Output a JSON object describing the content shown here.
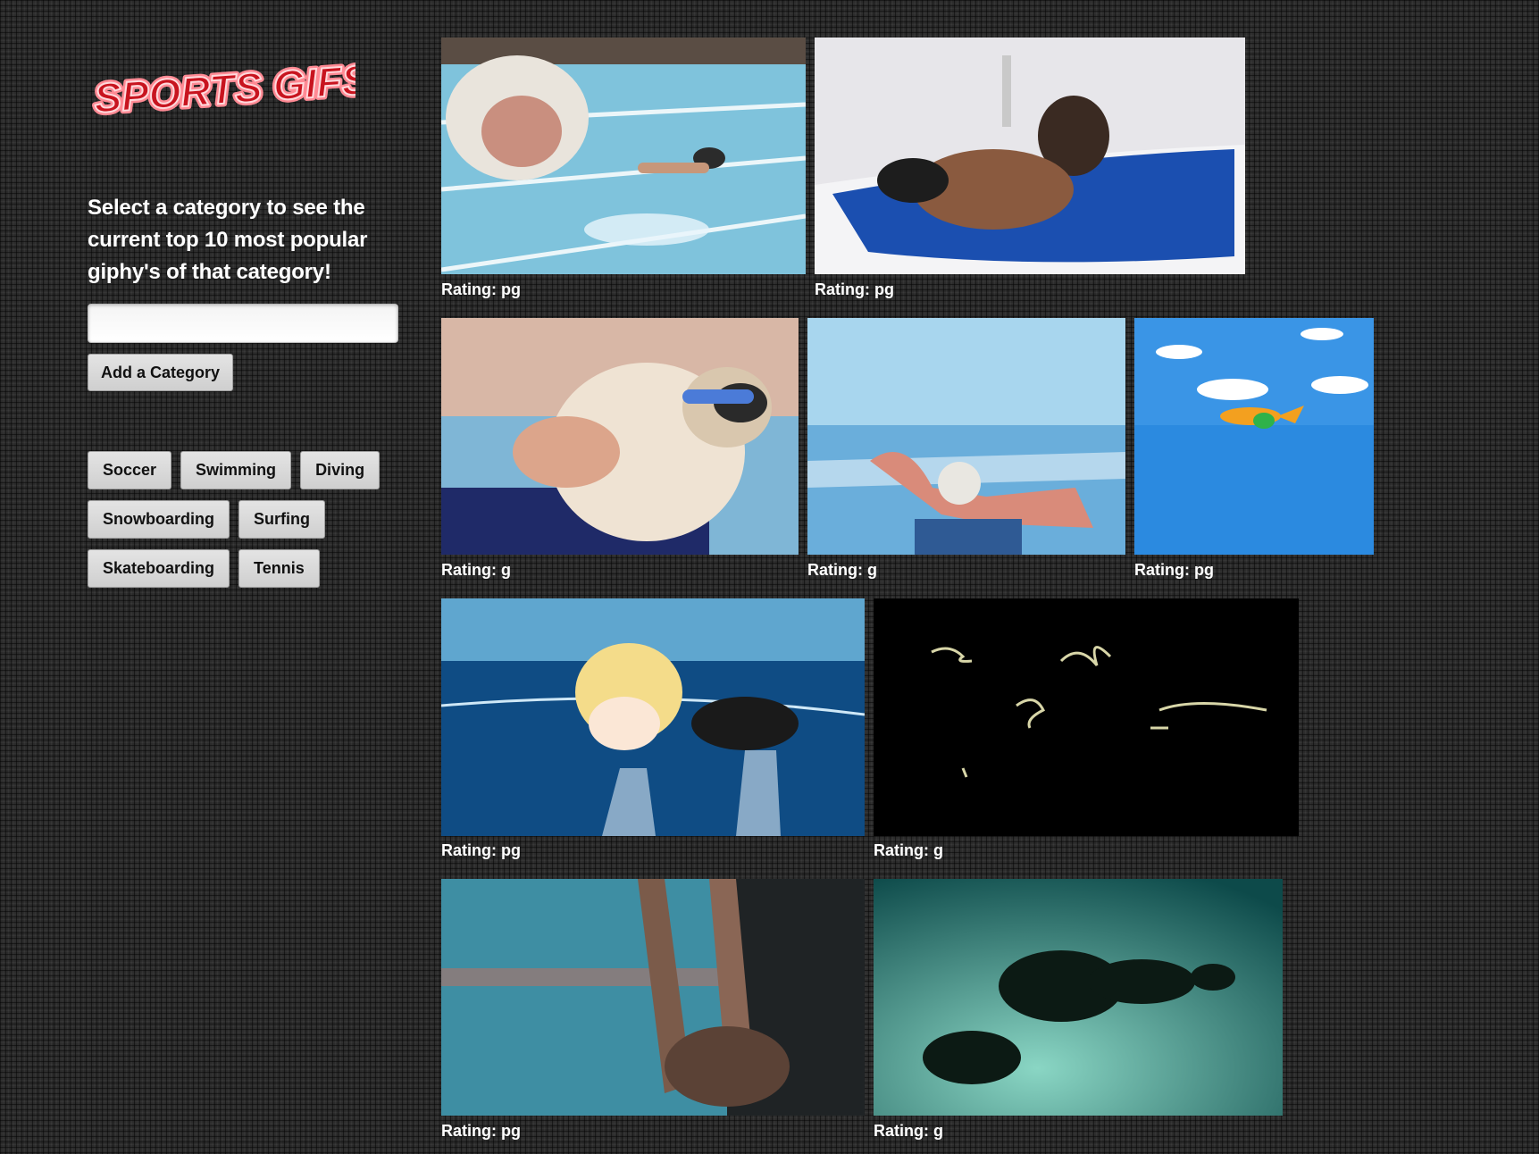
{
  "header": {
    "logo_text": "SPORTS GIFS",
    "logo_color": "#e0283a"
  },
  "sidebar": {
    "intro": "Select a category to see the current top 10 most popular giphy's of that category!",
    "search": {
      "value": "",
      "placeholder": ""
    },
    "add_button_label": "Add a Category",
    "categories": [
      "Soccer",
      "Swimming",
      "Diving",
      "Snowboarding",
      "Surfing",
      "Skateboarding",
      "Tennis"
    ]
  },
  "gifs": [
    {
      "description": "shark-chasing-swimmer-gif",
      "rating_label": "Rating: pg"
    },
    {
      "description": "man-in-ice-bath-gif",
      "rating_label": "Rating: pg"
    },
    {
      "description": "pug-with-goggles-gif",
      "rating_label": "Rating: g"
    },
    {
      "description": "cartoon-swimmer-gif",
      "rating_label": "Rating: g"
    },
    {
      "description": "cartoon-fish-sky-gif",
      "rating_label": "Rating: pg"
    },
    {
      "description": "anime-girl-swimming-gif",
      "rating_label": "Rating: pg"
    },
    {
      "description": "glowing-squiggles-gif",
      "rating_label": "Rating: g"
    },
    {
      "description": "hands-in-pool-gif",
      "rating_label": "Rating: pg"
    },
    {
      "description": "underwater-swimmer-silhouette-gif",
      "rating_label": "Rating: g"
    }
  ]
}
